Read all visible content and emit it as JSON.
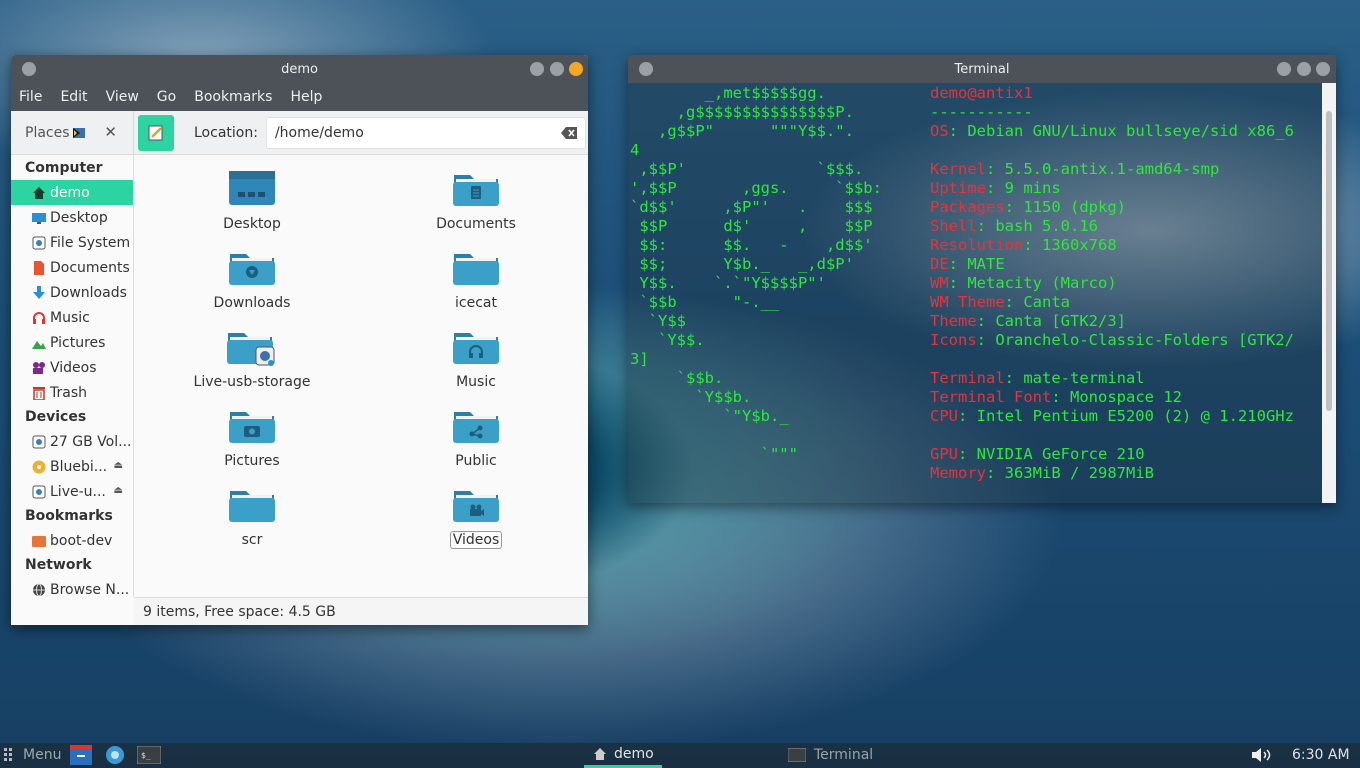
{
  "file_manager": {
    "title": "demo",
    "menu": [
      "File",
      "Edit",
      "View",
      "Go",
      "Bookmarks",
      "Help"
    ],
    "places_label": "Places",
    "location_label": "Location:",
    "location_value": "/home/demo",
    "sidebar": {
      "computer_heading": "Computer",
      "computer_items": [
        {
          "label": "demo",
          "icon": "home-icon",
          "active": true
        },
        {
          "label": "Desktop",
          "icon": "desktop-icon"
        },
        {
          "label": "File System",
          "icon": "drive-icon"
        },
        {
          "label": "Documents",
          "icon": "document-icon"
        },
        {
          "label": "Downloads",
          "icon": "download-icon"
        },
        {
          "label": "Music",
          "icon": "headphones-icon"
        },
        {
          "label": "Pictures",
          "icon": "picture-icon"
        },
        {
          "label": "Videos",
          "icon": "video-icon"
        },
        {
          "label": "Trash",
          "icon": "trash-icon"
        }
      ],
      "devices_heading": "Devices",
      "device_items": [
        {
          "label": "27 GB Vol...",
          "icon": "drive-icon"
        },
        {
          "label": "Bluebi...",
          "icon": "disc-icon"
        },
        {
          "label": "Live-u...",
          "icon": "drive-icon"
        }
      ],
      "bookmarks_heading": "Bookmarks",
      "bookmark_items": [
        {
          "label": "boot-dev",
          "icon": "folder-icon"
        }
      ],
      "network_heading": "Network",
      "network_items": [
        {
          "label": "Browse N...",
          "icon": "globe-icon"
        }
      ]
    },
    "files": [
      {
        "name": "Desktop",
        "glyph": "desktop"
      },
      {
        "name": "Documents",
        "glyph": "document"
      },
      {
        "name": "Downloads",
        "glyph": "download"
      },
      {
        "name": "icecat",
        "glyph": "none"
      },
      {
        "name": "Live-usb-storage",
        "glyph": "disk"
      },
      {
        "name": "Music",
        "glyph": "headphones"
      },
      {
        "name": "Pictures",
        "glyph": "camera"
      },
      {
        "name": "Public",
        "glyph": "share"
      },
      {
        "name": "scr",
        "glyph": "none"
      },
      {
        "name": "Videos",
        "glyph": "video"
      }
    ],
    "status": "9 items, Free space: 4.5 GB"
  },
  "terminal": {
    "title": "Terminal",
    "logo_lines": [
      "        _,met$$$$$gg.",
      "     ,g$$$$$$$$$$$$$$$P.",
      "   ,g$$P\"      \"\"\"Y$$.\".",
      "4",
      " ,$$P'              `$$$.",
      "',$$P       ,ggs.     `$$b:",
      "`d$$'     ,$P\"'   .    $$$",
      " $$P      d$'     ,    $$P",
      " $$:      $$.   -    ,d$$'",
      " $$;      Y$b._   _,d$P'",
      " Y$$.    `.`\"Y$$$$P\"'",
      " `$$b      \"-.__",
      "  `Y$$",
      "   `Y$$.",
      "3]",
      "     `$$b.",
      "       `Y$$b.",
      "          `\"Y$b._",
      "",
      "              `\"\"\""
    ],
    "user_host": "demo@antix1",
    "separator": "-----------",
    "info": [
      {
        "key": "OS",
        "value": "Debian GNU/Linux bullseye/sid x86_6"
      },
      {
        "key": "Kernel",
        "value": "5.5.0-antix.1-amd64-smp"
      },
      {
        "key": "Uptime",
        "value": "9 mins"
      },
      {
        "key": "Packages",
        "value": "1150 (dpkg)"
      },
      {
        "key": "Shell",
        "value": "bash 5.0.16"
      },
      {
        "key": "Resolution",
        "value": "1360x768"
      },
      {
        "key": "DE",
        "value": "MATE"
      },
      {
        "key": "WM",
        "value": "Metacity (Marco)"
      },
      {
        "key": "WM Theme",
        "value": "Canta"
      },
      {
        "key": "Theme",
        "value": "Canta [GTK2/3]"
      },
      {
        "key": "Icons",
        "value": "Oranchelo-Classic-Folders [GTK2/"
      },
      {
        "key": "Terminal",
        "value": "mate-terminal"
      },
      {
        "key": "Terminal Font",
        "value": "Monospace 12"
      },
      {
        "key": "CPU",
        "value": "Intel Pentium E5200 (2) @ 1.210GHz"
      },
      {
        "key": "GPU",
        "value": "NVIDIA GeForce 210"
      },
      {
        "key": "Memory",
        "value": "363MiB / 2987MiB"
      }
    ]
  },
  "taskbar": {
    "menu_label": "Menu",
    "tasks": [
      {
        "label": "demo",
        "icon": "home-icon"
      },
      {
        "label": "Terminal",
        "icon": "terminal-icon"
      }
    ],
    "clock": "6:30 AM"
  },
  "colors": {
    "accent": "#2bd4a0",
    "folder": "#3aa0c8",
    "terminal_green": "#2ee83a",
    "terminal_red": "#e8333a"
  }
}
